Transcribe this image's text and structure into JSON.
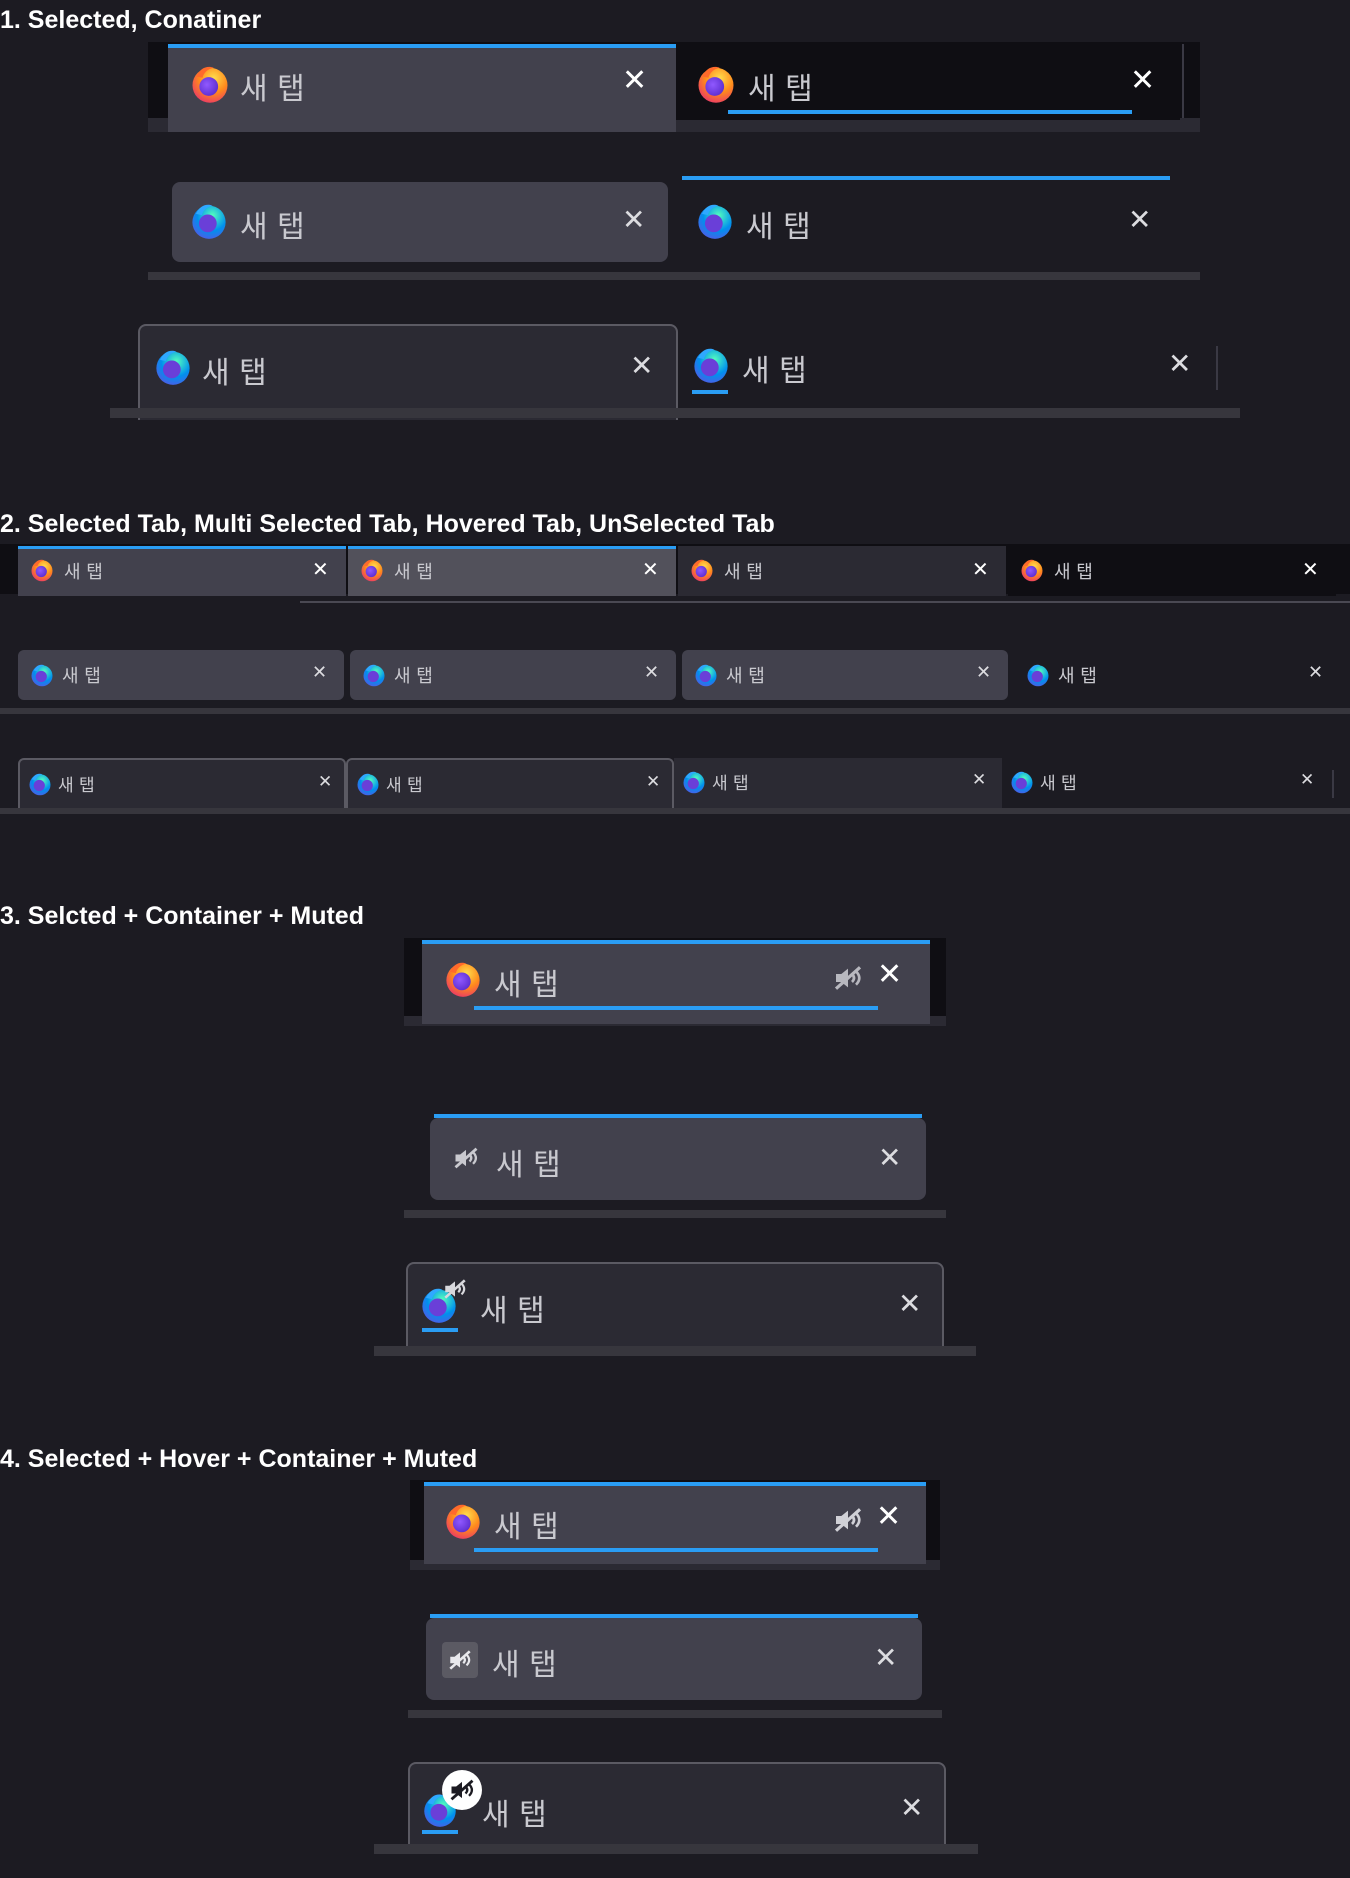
{
  "sections": [
    {
      "title": "1. Selected, Conatiner"
    },
    {
      "title": "2. Selected Tab, Multi Selected Tab, Hovered Tab, UnSelected Tab"
    },
    {
      "title": "3. Selcted + Container + Muted"
    },
    {
      "title": "4. Selected + Hover + Container + Muted"
    }
  ],
  "tab": {
    "label": "새 탭",
    "close_glyph": "✕"
  },
  "colors": {
    "page_background": "#1c1b22",
    "container_line": "#2a9df4",
    "selected_tab": "#42414d",
    "dark_tab": "#0f0e13",
    "tab_text": "#c9c9cf"
  },
  "icons": [
    "firefox-icon",
    "close-icon",
    "mute-icon"
  ]
}
